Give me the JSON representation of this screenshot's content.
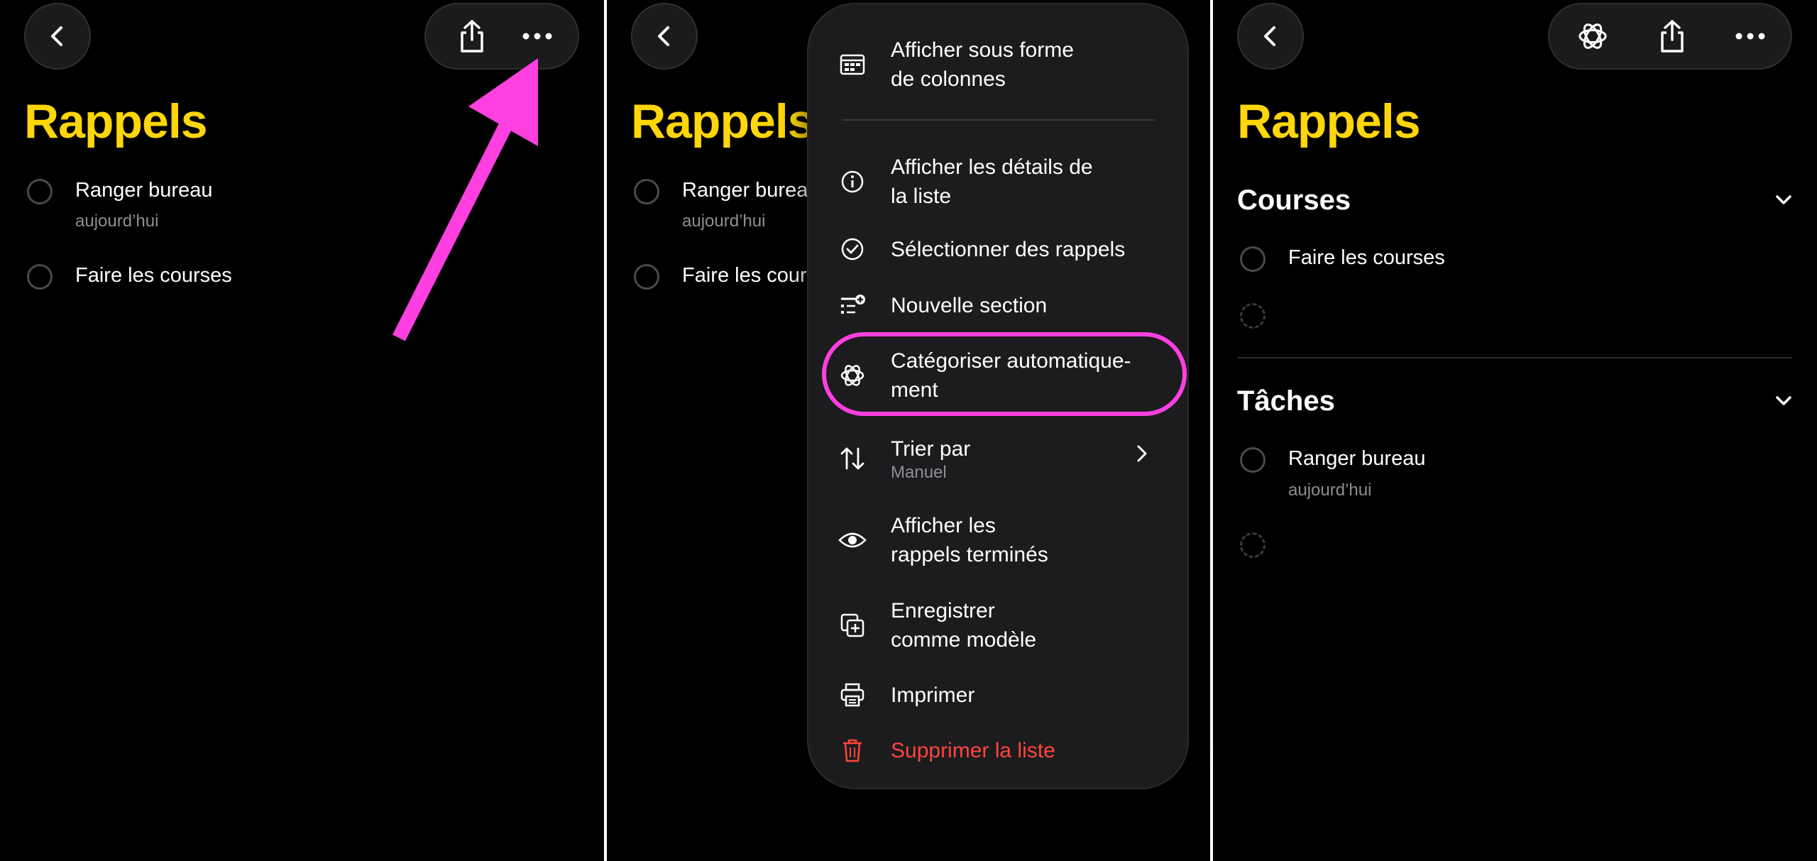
{
  "panels": {
    "left": {
      "title": "Rappels",
      "items": [
        {
          "text": "Ranger bureau",
          "sub": "aujourd’hui"
        },
        {
          "text": "Faire les courses",
          "sub": ""
        }
      ],
      "icons": [
        "chevron-left-icon",
        "share-icon",
        "more-icon"
      ]
    },
    "middle": {
      "title": "Rappels",
      "items": [
        {
          "text": "Ranger bureau",
          "sub": "aujourd’hui"
        },
        {
          "text": "Faire les courses",
          "sub": ""
        }
      ],
      "menu": {
        "items": [
          {
            "icon": "columns-icon",
            "line1": "Afficher sous forme",
            "line2": "de colonnes"
          },
          {
            "icon": "info-icon",
            "line1": "Afficher les détails de",
            "line2": "la liste"
          },
          {
            "icon": "checkmark-circle-icon",
            "line1": "Sélectionner des rappels"
          },
          {
            "icon": "new-section-icon",
            "line1": "Nouvelle section"
          },
          {
            "icon": "sparkle-icon",
            "line1": "Catégoriser automatique-",
            "line2": "ment"
          },
          {
            "icon": "sort-icon",
            "line1": "Trier par",
            "sub": "Manuel"
          },
          {
            "icon": "eye-icon",
            "line1": "Afficher les",
            "line2": "rappels terminés"
          },
          {
            "icon": "template-icon",
            "line1": "Enregistrer",
            "line2": "comme modèle"
          },
          {
            "icon": "printer-icon",
            "line1": "Imprimer"
          },
          {
            "icon": "trash-icon",
            "line1": "Supprimer la liste"
          }
        ]
      }
    },
    "right": {
      "title": "Rappels",
      "sections": [
        {
          "title": "Courses",
          "items": [
            {
              "text": "Faire les courses",
              "sub": ""
            }
          ]
        },
        {
          "title": "Tâches",
          "items": [
            {
              "text": "Ranger bureau",
              "sub": "aujourd’hui"
            }
          ]
        }
      ]
    }
  },
  "colors": {
    "accent_yellow": "#ffd60a",
    "annotation_magenta": "#ff3fe0",
    "danger_red": "#ff453a",
    "background": "#000000"
  }
}
